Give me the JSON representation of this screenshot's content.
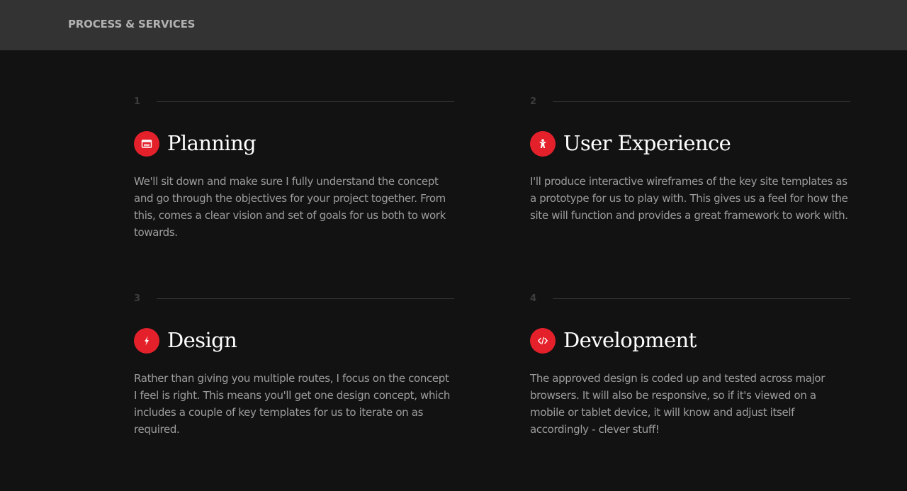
{
  "header": {
    "title": "PROCESS & SERVICES"
  },
  "steps": [
    {
      "number": "1",
      "icon": "browser-window-icon",
      "title": "Planning",
      "text": "We'll sit down and make sure I fully understand the concept and go through the objectives for your project together. From this, comes a clear vision and set of goals for us both to work towards."
    },
    {
      "number": "2",
      "icon": "user-person-icon",
      "title": "User Experience",
      "text": "I'll produce interactive wireframes of the key site templates as a prototype for us to play with. This gives us a feel for how the site will function and provides a great framework to work with."
    },
    {
      "number": "3",
      "icon": "lightning-bolt-icon",
      "title": "Design",
      "text": "Rather than giving you multiple routes, I focus on the concept I feel is right. This means you'll get one design concept, which includes a couple of key templates for us to iterate on as required."
    },
    {
      "number": "4",
      "icon": "code-brackets-icon",
      "title": "Development",
      "text": "The approved design is coded up and tested across major browsers. It will also be responsive, so if it's viewed on a mobile or tablet device, it will know and adjust itself accordingly - clever stuff!"
    }
  ],
  "colors": {
    "background": "#121213",
    "header_background": "#333334",
    "accent": "#e4212b"
  }
}
